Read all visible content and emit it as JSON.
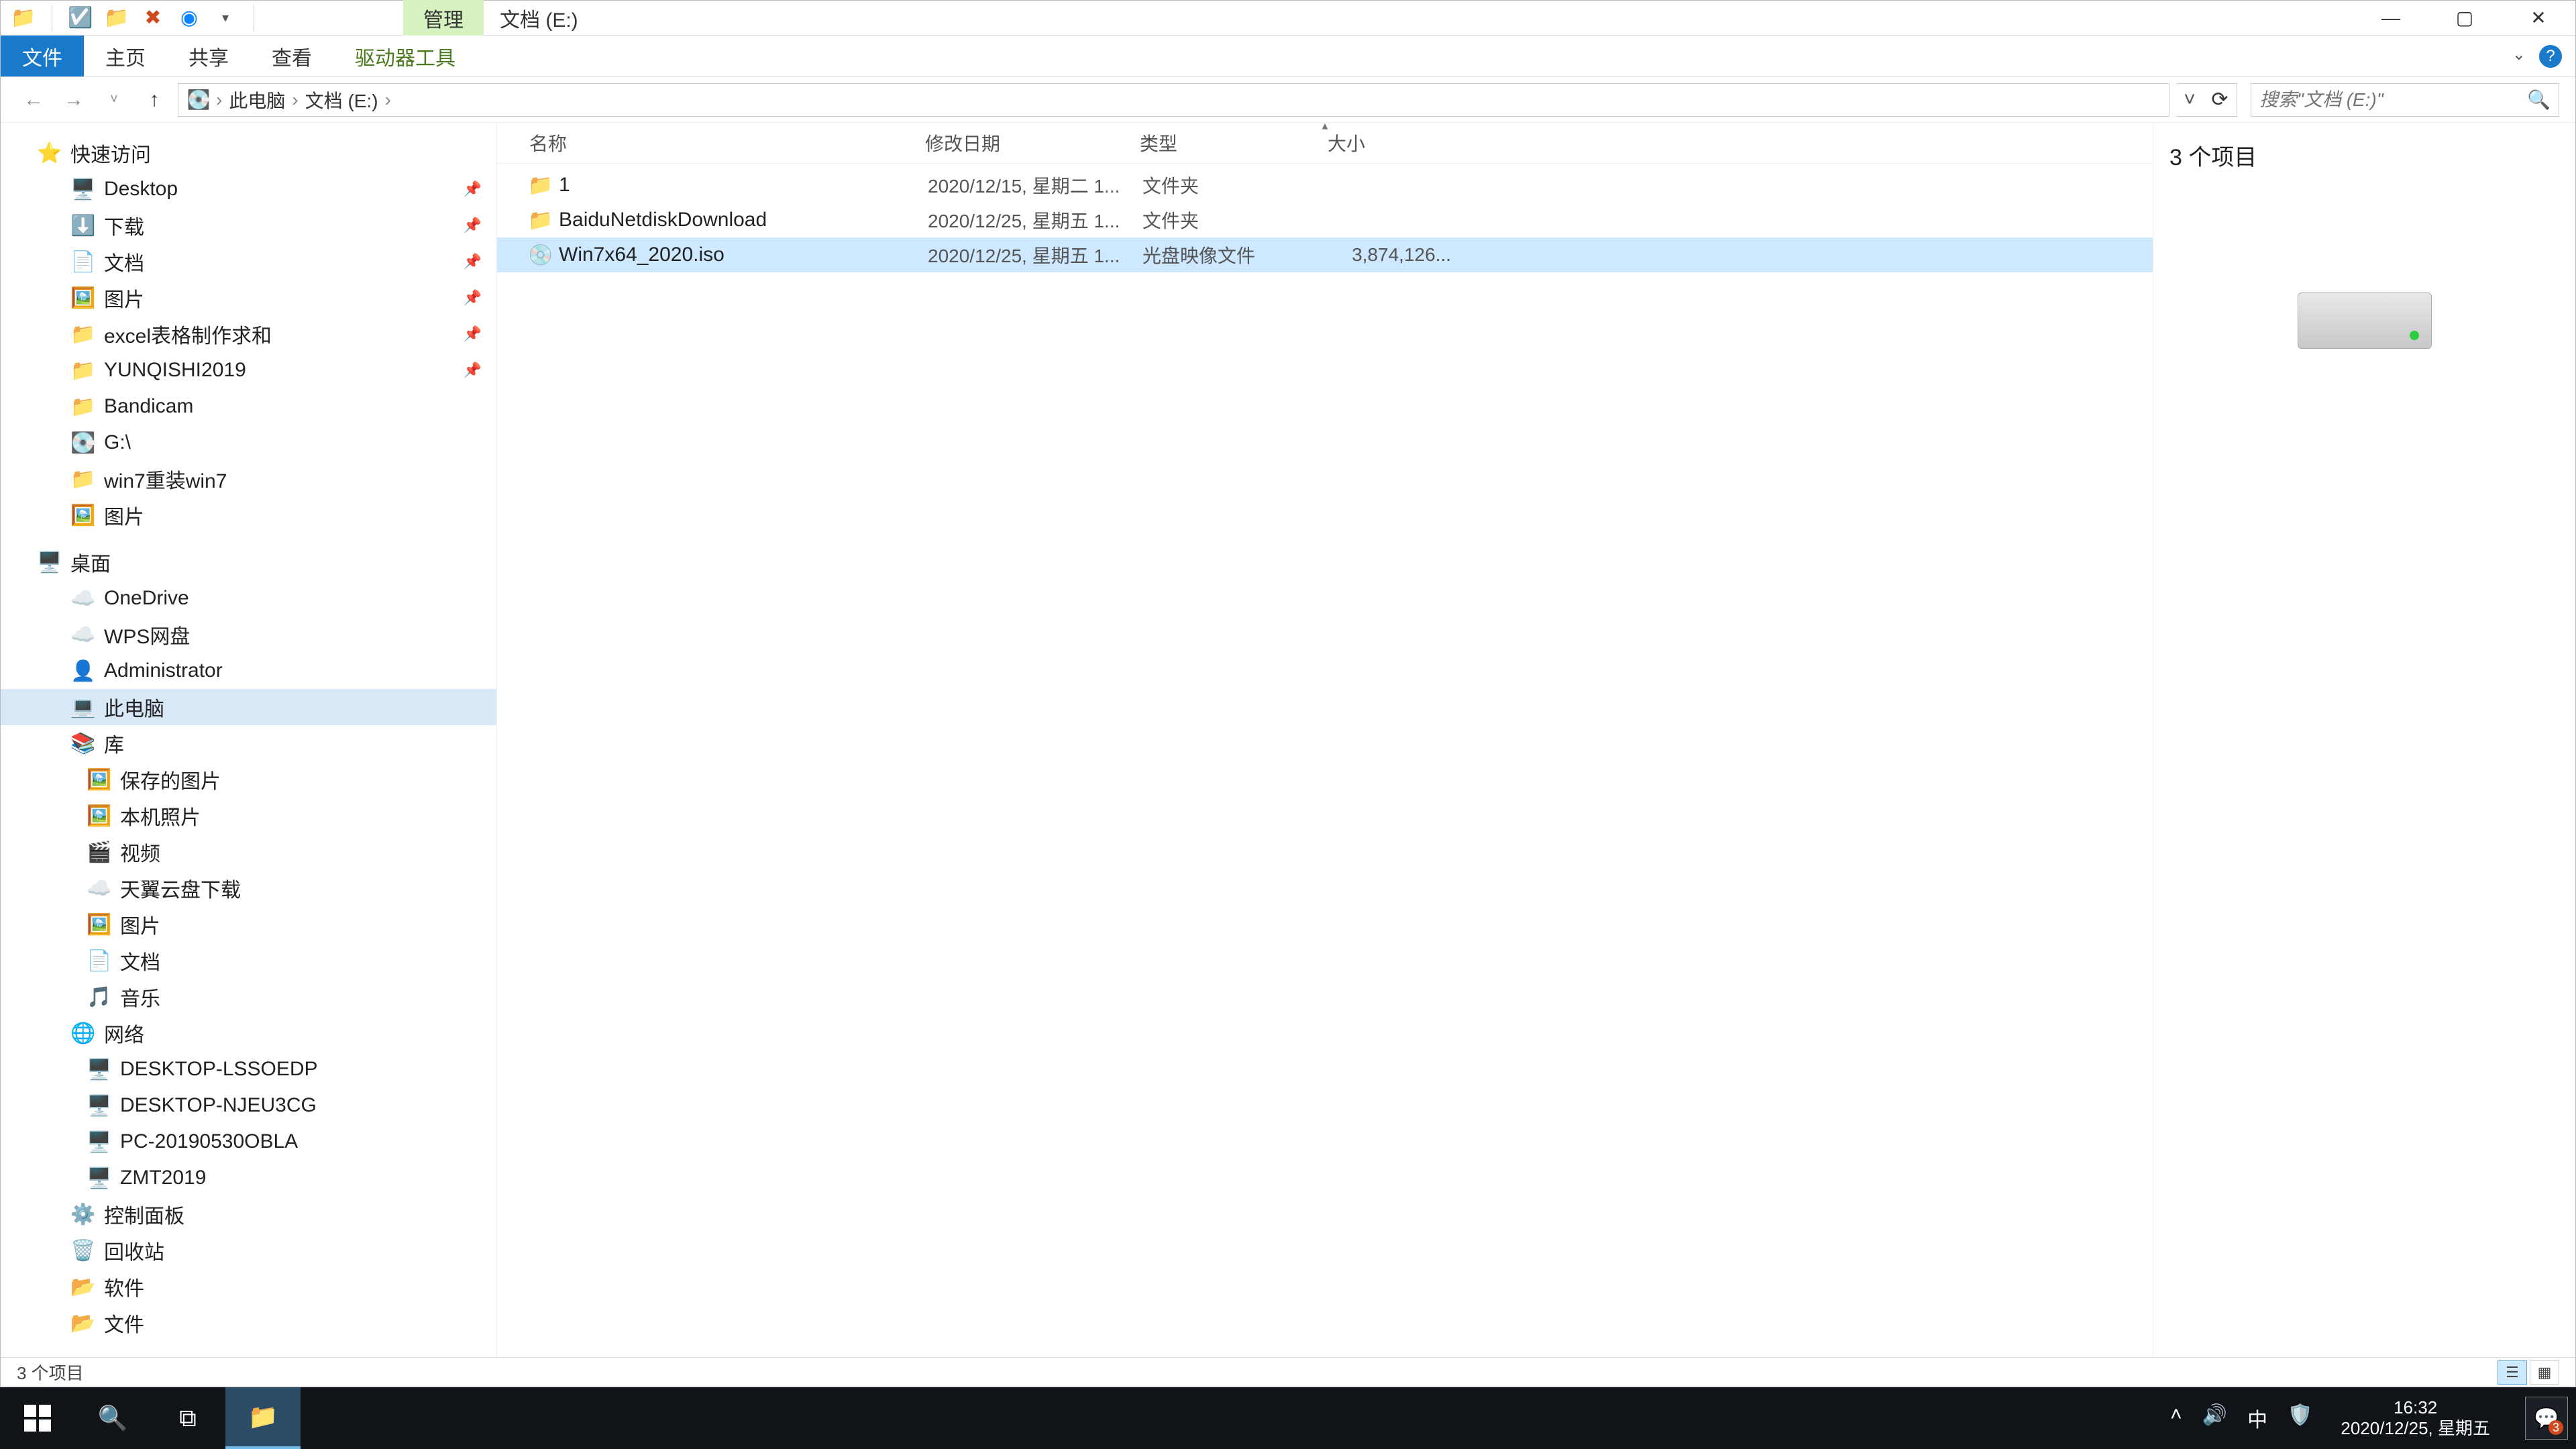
{
  "titlebar": {
    "context_tab": "管理",
    "path_title": "文档 (E:)"
  },
  "ribbon": {
    "file": "文件",
    "home": "主页",
    "share": "共享",
    "view": "查看",
    "drive_tools": "驱动器工具"
  },
  "breadcrumb": {
    "seg1": "此电脑",
    "seg2": "文档 (E:)"
  },
  "search": {
    "placeholder": "搜索\"文档 (E:)\""
  },
  "sidebar": {
    "quick_access": "快速访问",
    "desktop": "Desktop",
    "downloads": "下载",
    "documents": "文档",
    "pictures": "图片",
    "excel": "excel表格制作求和",
    "yunqishi": "YUNQISHI2019",
    "bandicam": "Bandicam",
    "g_drive": "G:\\",
    "win7reinstall": "win7重装win7",
    "pictures2": "图片",
    "desktop_root": "桌面",
    "onedrive": "OneDrive",
    "wps": "WPS网盘",
    "admin": "Administrator",
    "thispc": "此电脑",
    "libraries": "库",
    "savedpic": "保存的图片",
    "localphoto": "本机照片",
    "video": "视频",
    "tianyi": "天翼云盘下载",
    "pictures3": "图片",
    "documents2": "文档",
    "music": "音乐",
    "network": "网络",
    "netpc1": "DESKTOP-LSSOEDP",
    "netpc2": "DESKTOP-NJEU3CG",
    "netpc3": "PC-20190530OBLA",
    "netpc4": "ZMT2019",
    "controlpanel": "控制面板",
    "recyclebin": "回收站",
    "software": "软件",
    "files": "文件"
  },
  "columns": {
    "name": "名称",
    "date": "修改日期",
    "type": "类型",
    "size": "大小"
  },
  "files": [
    {
      "name": "1",
      "date": "2020/12/15, 星期二 1...",
      "type": "文件夹",
      "size": "",
      "icon": "folder"
    },
    {
      "name": "BaiduNetdiskDownload",
      "date": "2020/12/25, 星期五 1...",
      "type": "文件夹",
      "size": "",
      "icon": "folder"
    },
    {
      "name": "Win7x64_2020.iso",
      "date": "2020/12/25, 星期五 1...",
      "type": "光盘映像文件",
      "size": "3,874,126...",
      "icon": "iso"
    }
  ],
  "preview": {
    "count_label": "3 个项目"
  },
  "statusbar": {
    "count": "3 个项目"
  },
  "tray": {
    "ime": "中",
    "time": "16:32",
    "date": "2020/12/25, 星期五",
    "notif_count": "3"
  }
}
